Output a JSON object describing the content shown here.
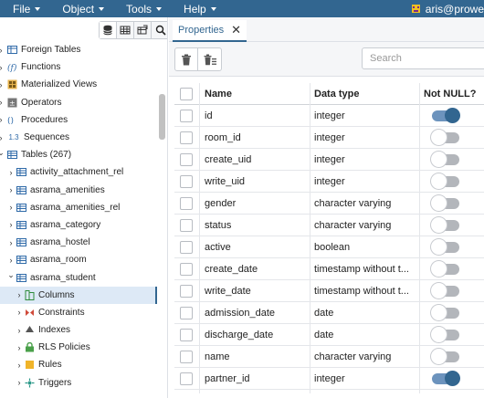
{
  "menubar": {
    "items": [
      "File",
      "Object",
      "Tools",
      "Help"
    ],
    "user": "aris@prowe"
  },
  "tree": {
    "items": [
      {
        "label": "Foreign Tables",
        "icon": "foreign-table-icon",
        "indent": 0,
        "expandable": true,
        "expanded": false
      },
      {
        "label": "Functions",
        "icon": "function-icon",
        "indent": 0,
        "expandable": true,
        "expanded": false
      },
      {
        "label": "Materialized Views",
        "icon": "materialized-view-icon",
        "indent": 0,
        "expandable": true,
        "expanded": false
      },
      {
        "label": "Operators",
        "icon": "operator-icon",
        "indent": 0,
        "expandable": true,
        "expanded": false
      },
      {
        "label": "Procedures",
        "icon": "procedure-icon",
        "indent": 0,
        "expandable": true,
        "expanded": false
      },
      {
        "label": "Sequences",
        "icon": "sequence-icon",
        "icon_text": "1.3",
        "indent": 0,
        "expandable": true,
        "expanded": false
      },
      {
        "label": "Tables (267)",
        "icon": "tables-icon",
        "indent": 0,
        "expandable": true,
        "expanded": true
      },
      {
        "label": "activity_attachment_rel",
        "icon": "table-icon",
        "indent": 1,
        "expandable": true,
        "expanded": false
      },
      {
        "label": "asrama_amenities",
        "icon": "table-icon",
        "indent": 1,
        "expandable": true,
        "expanded": false
      },
      {
        "label": "asrama_amenities_rel",
        "icon": "table-icon",
        "indent": 1,
        "expandable": true,
        "expanded": false
      },
      {
        "label": "asrama_category",
        "icon": "table-icon",
        "indent": 1,
        "expandable": true,
        "expanded": false
      },
      {
        "label": "asrama_hostel",
        "icon": "table-icon",
        "indent": 1,
        "expandable": true,
        "expanded": false
      },
      {
        "label": "asrama_room",
        "icon": "table-icon",
        "indent": 1,
        "expandable": true,
        "expanded": false
      },
      {
        "label": "asrama_student",
        "icon": "table-icon",
        "indent": 1,
        "expandable": true,
        "expanded": true
      },
      {
        "label": "Columns",
        "icon": "columns-icon",
        "indent": 2,
        "expandable": true,
        "expanded": false,
        "selected": true
      },
      {
        "label": "Constraints",
        "icon": "constraints-icon",
        "indent": 2,
        "expandable": true,
        "expanded": false
      },
      {
        "label": "Indexes",
        "icon": "indexes-icon",
        "indent": 2,
        "expandable": true,
        "expanded": false
      },
      {
        "label": "RLS Policies",
        "icon": "rls-policies-icon",
        "indent": 2,
        "expandable": true,
        "expanded": false
      },
      {
        "label": "Rules",
        "icon": "rules-icon",
        "indent": 2,
        "expandable": true,
        "expanded": false
      },
      {
        "label": "Triggers",
        "icon": "triggers-icon",
        "indent": 2,
        "expandable": true,
        "expanded": false
      }
    ]
  },
  "tabs": [
    {
      "label": "Properties",
      "close": "✕"
    }
  ],
  "search": {
    "placeholder": "Search"
  },
  "table": {
    "headers": {
      "name": "Name",
      "type": "Data type",
      "not_null": "Not NULL?"
    },
    "rows": [
      {
        "name": "id",
        "type": "integer",
        "not_null": true
      },
      {
        "name": "room_id",
        "type": "integer",
        "not_null": false
      },
      {
        "name": "create_uid",
        "type": "integer",
        "not_null": false
      },
      {
        "name": "write_uid",
        "type": "integer",
        "not_null": false
      },
      {
        "name": "gender",
        "type": "character varying",
        "not_null": false
      },
      {
        "name": "status",
        "type": "character varying",
        "not_null": false
      },
      {
        "name": "active",
        "type": "boolean",
        "not_null": false
      },
      {
        "name": "create_date",
        "type": "timestamp without t...",
        "not_null": false
      },
      {
        "name": "write_date",
        "type": "timestamp without t...",
        "not_null": false
      },
      {
        "name": "admission_date",
        "type": "date",
        "not_null": false
      },
      {
        "name": "discharge_date",
        "type": "date",
        "not_null": false
      },
      {
        "name": "name",
        "type": "character varying",
        "not_null": false
      },
      {
        "name": "partner_id",
        "type": "integer",
        "not_null": true
      }
    ]
  },
  "colors": {
    "menubar": "#326690",
    "toggle_on": "#326690",
    "toggle_off": "#b3b6bb",
    "selected_row": "#dde9f6"
  }
}
